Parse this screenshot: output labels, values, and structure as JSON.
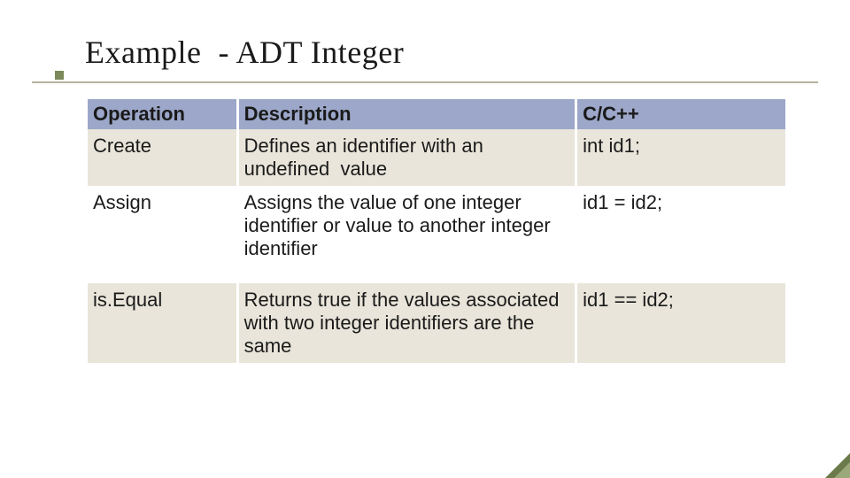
{
  "slide": {
    "title": "Example  - ADT Integer"
  },
  "table": {
    "headers": {
      "operation": "Operation",
      "description": "Description",
      "ccpp": "C/C++"
    },
    "rows": [
      {
        "operation": "Create",
        "description": "Defines an identifier with an undefined  value",
        "ccpp": "int id1;"
      },
      {
        "operation": "Assign",
        "description": "Assigns the value of one integer identifier or value to another integer identifier",
        "ccpp": "id1 = id2;"
      },
      {
        "operation": "is.Equal",
        "description": "Returns true if the values associated  with two integer identifiers are the same",
        "ccpp": "id1 == id2;"
      }
    ]
  },
  "colors": {
    "header_bg": "#9ca7c9",
    "row_alt_bg": "#e9e5da",
    "bullet": "#7a8a5a",
    "underline": "#b8b0a0"
  }
}
